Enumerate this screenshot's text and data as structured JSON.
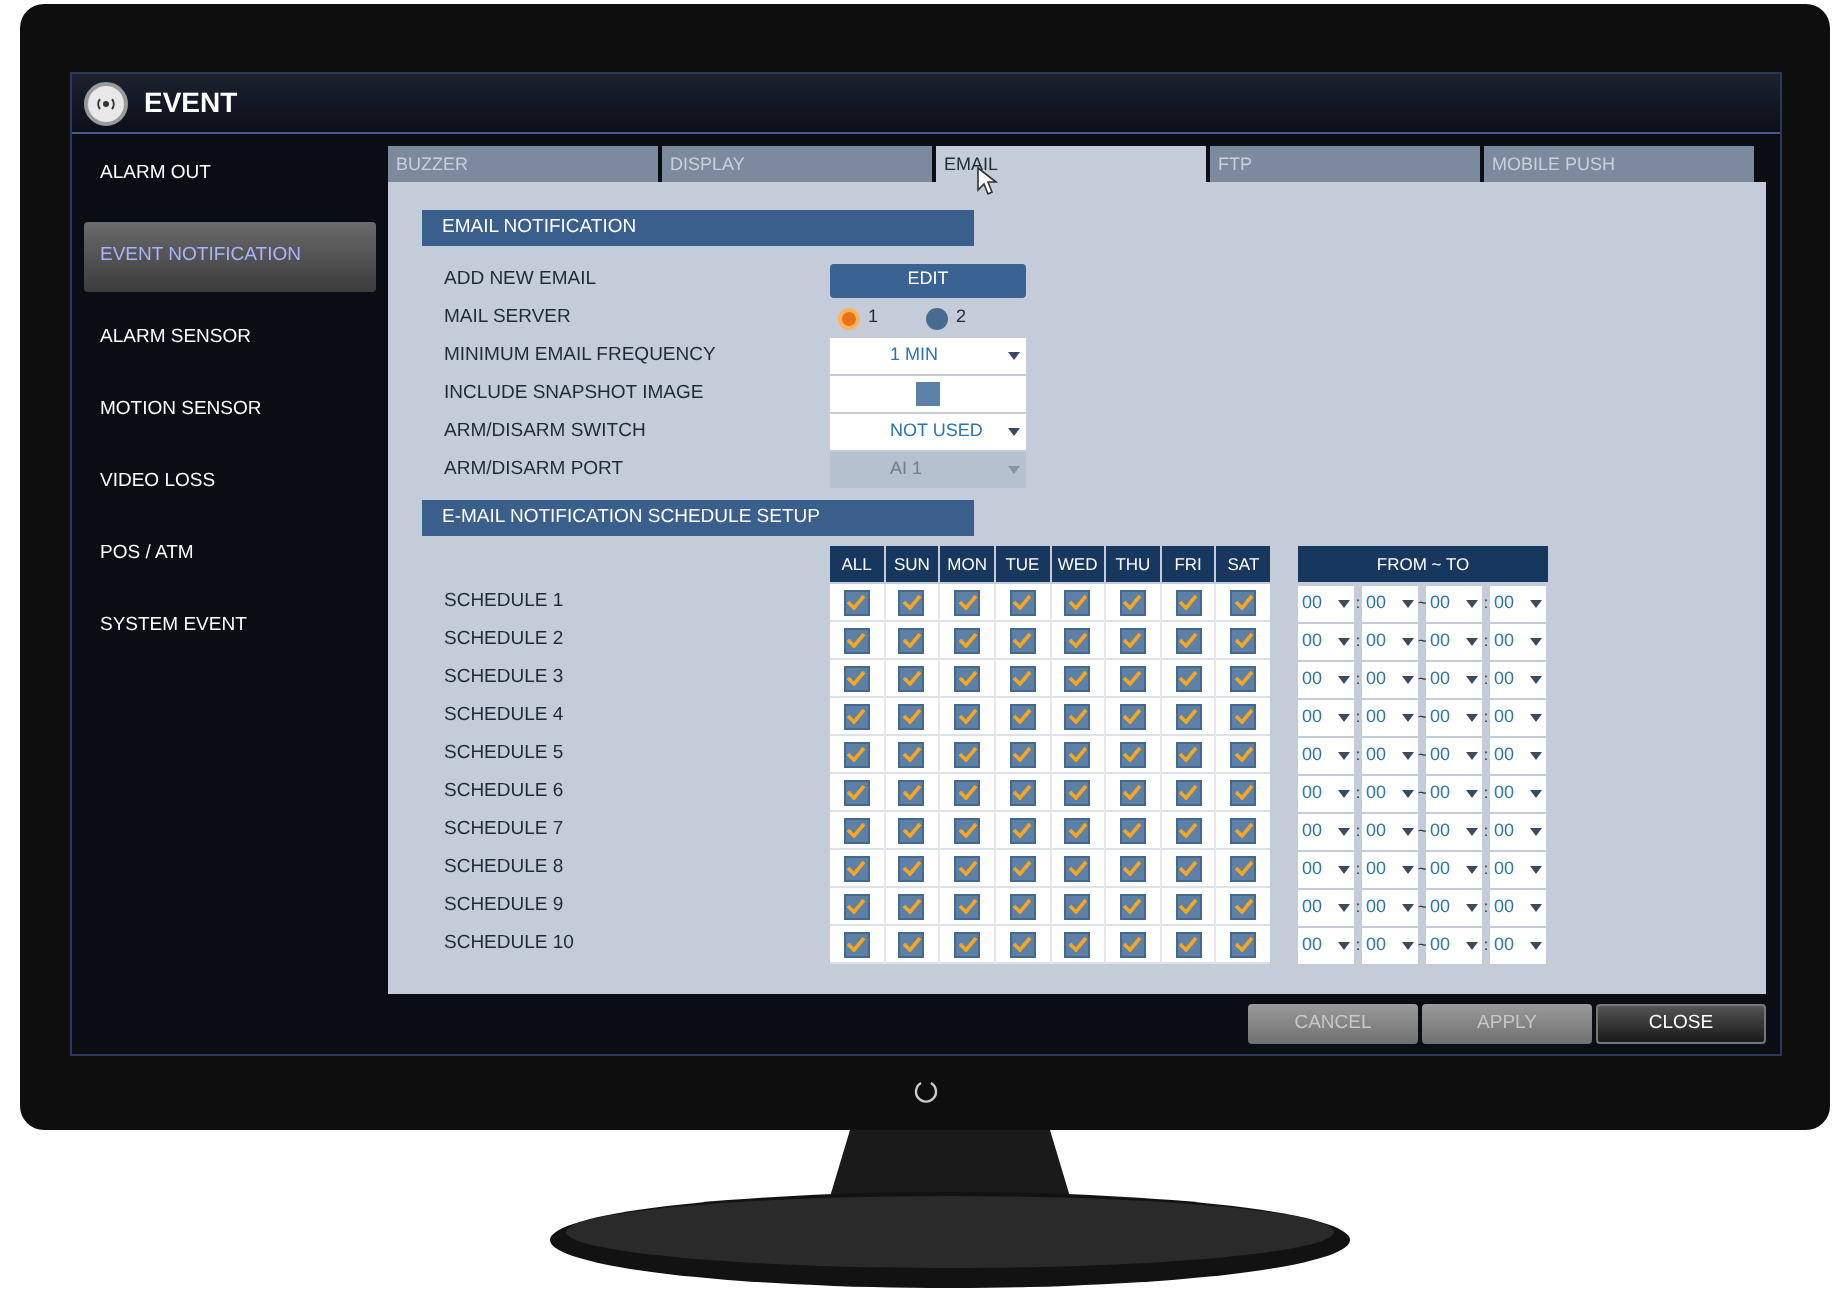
{
  "window": {
    "title": "EVENT"
  },
  "sidebar": {
    "items": [
      {
        "label": "ALARM OUT",
        "selected": false
      },
      {
        "label": "EVENT NOTIFICATION",
        "selected": true
      },
      {
        "label": "ALARM SENSOR",
        "selected": false
      },
      {
        "label": "MOTION SENSOR",
        "selected": false
      },
      {
        "label": "VIDEO LOSS",
        "selected": false
      },
      {
        "label": "POS / ATM",
        "selected": false
      },
      {
        "label": "SYSTEM EVENT",
        "selected": false
      }
    ]
  },
  "tabs": [
    {
      "label": "BUZZER",
      "selected": false
    },
    {
      "label": "DISPLAY",
      "selected": false
    },
    {
      "label": "EMAIL",
      "selected": true
    },
    {
      "label": "FTP",
      "selected": false
    },
    {
      "label": "MOBILE PUSH",
      "selected": false
    }
  ],
  "email_notification": {
    "title": "EMAIL NOTIFICATION",
    "rows": [
      {
        "kind": "button",
        "label": "ADD NEW EMAIL",
        "value": "EDIT"
      },
      {
        "kind": "radio",
        "label": "MAIL SERVER",
        "options": [
          {
            "label": "1",
            "selected": true
          },
          {
            "label": "2",
            "selected": false
          }
        ]
      },
      {
        "kind": "select",
        "label": "MINIMUM EMAIL FREQUENCY",
        "value": "1 MIN",
        "disabled": false
      },
      {
        "kind": "checkbox",
        "label": "INCLUDE SNAPSHOT IMAGE",
        "checked": false
      },
      {
        "kind": "select",
        "label": "ARM/DISARM SWITCH",
        "value": "NOT USED",
        "disabled": false
      },
      {
        "kind": "select",
        "label": "ARM/DISARM PORT",
        "value": "AI 1",
        "disabled": true
      }
    ]
  },
  "schedule_setup": {
    "title": "E-MAIL NOTIFICATION SCHEDULE SETUP",
    "day_columns": [
      "ALL",
      "SUN",
      "MON",
      "TUE",
      "WED",
      "THU",
      "FRI",
      "SAT"
    ],
    "time_header": "FROM ~ TO",
    "rows": [
      {
        "label": "SCHEDULE 1",
        "days": [
          true,
          true,
          true,
          true,
          true,
          true,
          true,
          true
        ],
        "time": [
          {
            "kind": "select",
            "value": "00"
          },
          {
            "kind": "sep",
            "value": ":"
          },
          {
            "kind": "select",
            "value": "00"
          },
          {
            "kind": "sep",
            "value": "~"
          },
          {
            "kind": "select",
            "value": "00"
          },
          {
            "kind": "sep",
            "value": ":"
          },
          {
            "kind": "select",
            "value": "00"
          }
        ]
      },
      {
        "label": "SCHEDULE 2",
        "days": [
          true,
          true,
          true,
          true,
          true,
          true,
          true,
          true
        ],
        "time": [
          {
            "kind": "select",
            "value": "00"
          },
          {
            "kind": "sep",
            "value": ":"
          },
          {
            "kind": "select",
            "value": "00"
          },
          {
            "kind": "sep",
            "value": "~"
          },
          {
            "kind": "select",
            "value": "00"
          },
          {
            "kind": "sep",
            "value": ":"
          },
          {
            "kind": "select",
            "value": "00"
          }
        ]
      },
      {
        "label": "SCHEDULE 3",
        "days": [
          true,
          true,
          true,
          true,
          true,
          true,
          true,
          true
        ],
        "time": [
          {
            "kind": "select",
            "value": "00"
          },
          {
            "kind": "sep",
            "value": ":"
          },
          {
            "kind": "select",
            "value": "00"
          },
          {
            "kind": "sep",
            "value": "~"
          },
          {
            "kind": "select",
            "value": "00"
          },
          {
            "kind": "sep",
            "value": ":"
          },
          {
            "kind": "select",
            "value": "00"
          }
        ]
      },
      {
        "label": "SCHEDULE 4",
        "days": [
          true,
          true,
          true,
          true,
          true,
          true,
          true,
          true
        ],
        "time": [
          {
            "kind": "select",
            "value": "00"
          },
          {
            "kind": "sep",
            "value": ":"
          },
          {
            "kind": "select",
            "value": "00"
          },
          {
            "kind": "sep",
            "value": "~"
          },
          {
            "kind": "select",
            "value": "00"
          },
          {
            "kind": "sep",
            "value": ":"
          },
          {
            "kind": "select",
            "value": "00"
          }
        ]
      },
      {
        "label": "SCHEDULE 5",
        "days": [
          true,
          true,
          true,
          true,
          true,
          true,
          true,
          true
        ],
        "time": [
          {
            "kind": "select",
            "value": "00"
          },
          {
            "kind": "sep",
            "value": ":"
          },
          {
            "kind": "select",
            "value": "00"
          },
          {
            "kind": "sep",
            "value": "~"
          },
          {
            "kind": "select",
            "value": "00"
          },
          {
            "kind": "sep",
            "value": ":"
          },
          {
            "kind": "select",
            "value": "00"
          }
        ]
      },
      {
        "label": "SCHEDULE 6",
        "days": [
          true,
          true,
          true,
          true,
          true,
          true,
          true,
          true
        ],
        "time": [
          {
            "kind": "select",
            "value": "00"
          },
          {
            "kind": "sep",
            "value": ":"
          },
          {
            "kind": "select",
            "value": "00"
          },
          {
            "kind": "sep",
            "value": "~"
          },
          {
            "kind": "select",
            "value": "00"
          },
          {
            "kind": "sep",
            "value": ":"
          },
          {
            "kind": "select",
            "value": "00"
          }
        ]
      },
      {
        "label": "SCHEDULE 7",
        "days": [
          true,
          true,
          true,
          true,
          true,
          true,
          true,
          true
        ],
        "time": [
          {
            "kind": "select",
            "value": "00"
          },
          {
            "kind": "sep",
            "value": ":"
          },
          {
            "kind": "select",
            "value": "00"
          },
          {
            "kind": "sep",
            "value": "~"
          },
          {
            "kind": "select",
            "value": "00"
          },
          {
            "kind": "sep",
            "value": ":"
          },
          {
            "kind": "select",
            "value": "00"
          }
        ]
      },
      {
        "label": "SCHEDULE 8",
        "days": [
          true,
          true,
          true,
          true,
          true,
          true,
          true,
          true
        ],
        "time": [
          {
            "kind": "select",
            "value": "00"
          },
          {
            "kind": "sep",
            "value": ":"
          },
          {
            "kind": "select",
            "value": "00"
          },
          {
            "kind": "sep",
            "value": "~"
          },
          {
            "kind": "select",
            "value": "00"
          },
          {
            "kind": "sep",
            "value": ":"
          },
          {
            "kind": "select",
            "value": "00"
          }
        ]
      },
      {
        "label": "SCHEDULE 9",
        "days": [
          true,
          true,
          true,
          true,
          true,
          true,
          true,
          true
        ],
        "time": [
          {
            "kind": "select",
            "value": "00"
          },
          {
            "kind": "sep",
            "value": ":"
          },
          {
            "kind": "select",
            "value": "00"
          },
          {
            "kind": "sep",
            "value": "~"
          },
          {
            "kind": "select",
            "value": "00"
          },
          {
            "kind": "sep",
            "value": ":"
          },
          {
            "kind": "select",
            "value": "00"
          }
        ]
      },
      {
        "label": "SCHEDULE 10",
        "days": [
          true,
          true,
          true,
          true,
          true,
          true,
          true,
          true
        ],
        "time": [
          {
            "kind": "select",
            "value": "00"
          },
          {
            "kind": "sep",
            "value": ":"
          },
          {
            "kind": "select",
            "value": "00"
          },
          {
            "kind": "sep",
            "value": "~"
          },
          {
            "kind": "select",
            "value": "00"
          },
          {
            "kind": "sep",
            "value": ":"
          },
          {
            "kind": "select",
            "value": "00"
          }
        ]
      }
    ]
  },
  "buttons": [
    {
      "label": "CANCEL",
      "disabled": true
    },
    {
      "label": "APPLY",
      "disabled": true
    },
    {
      "label": "CLOSE",
      "disabled": false
    }
  ]
}
